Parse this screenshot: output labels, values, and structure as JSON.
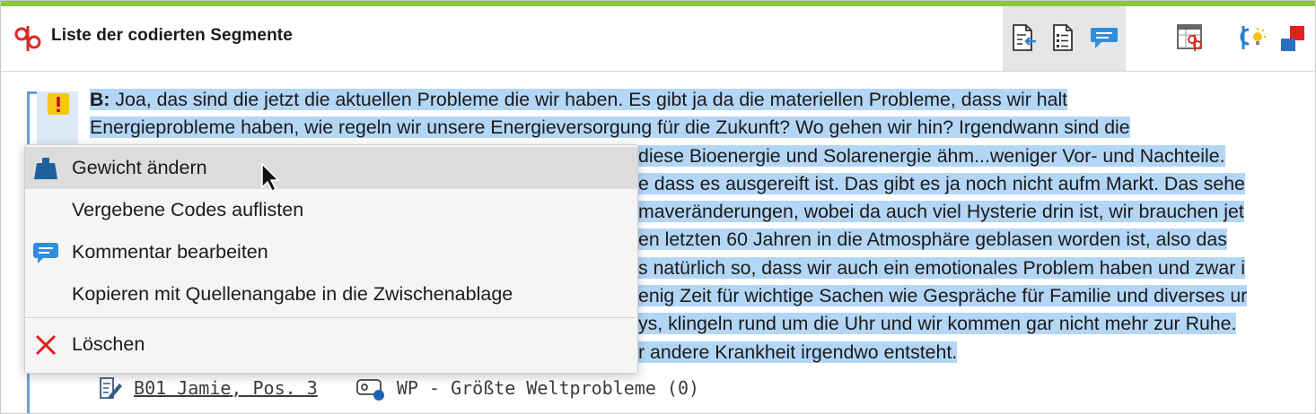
{
  "window": {
    "title": "Liste der codierten Segmente",
    "accent_color": "#8cc63f"
  },
  "toolbar": {
    "icons": [
      "import-icon",
      "list-icon",
      "comment-icon",
      "code-table-icon",
      "code-idea-icon",
      "color-square-icon"
    ]
  },
  "segment": {
    "speaker": "B:",
    "lines": [
      " Joa, das sind die jetzt die aktuellen Probleme die wir haben. Es gibt ja da die materiellen Probleme, dass wir halt",
      "Energieprobleme haben, wie regeln wir unsere Energieversorgung für die Zukunft? Wo gehen wir hin? Irgendwann sind die",
      "diese Bioenergie und Solarenergie ähm...weniger Vor- und Nachteile.",
      "e dass es ausgereift ist. Das gibt es ja noch nicht aufm Markt. Das sehe",
      "maveränderungen, wobei da auch viel Hysterie drin ist, wir brauchen jet",
      "en letzten 60 Jahren in die Atmosphäre geblasen worden ist, also das",
      "s natürlich so, dass wir auch ein emotionales Problem haben und zwar i",
      "enig Zeit für wichtige Sachen wie Gespräche für Familie und diverses ur",
      "ys, klingeln rund um die Uhr und wir kommen gar nicht mehr zur Ruhe.",
      "r andere Krankheit irgendwo entsteht."
    ],
    "highlight_color": "#b3d6f7"
  },
  "footer": {
    "document_ref": "B01 Jamie, Pos. 3",
    "code": "WP - Größte Weltprobleme (0)"
  },
  "context_menu": {
    "items": [
      {
        "label": "Gewicht ändern",
        "icon": "weight-icon"
      },
      {
        "label": "Vergebene Codes auflisten",
        "icon": ""
      },
      {
        "label": "Kommentar bearbeiten",
        "icon": "comment-icon"
      },
      {
        "label": "Kopieren mit Quellenangabe in die Zwischenablage",
        "icon": ""
      },
      {
        "label": "Löschen",
        "icon": "delete-icon"
      }
    ]
  }
}
